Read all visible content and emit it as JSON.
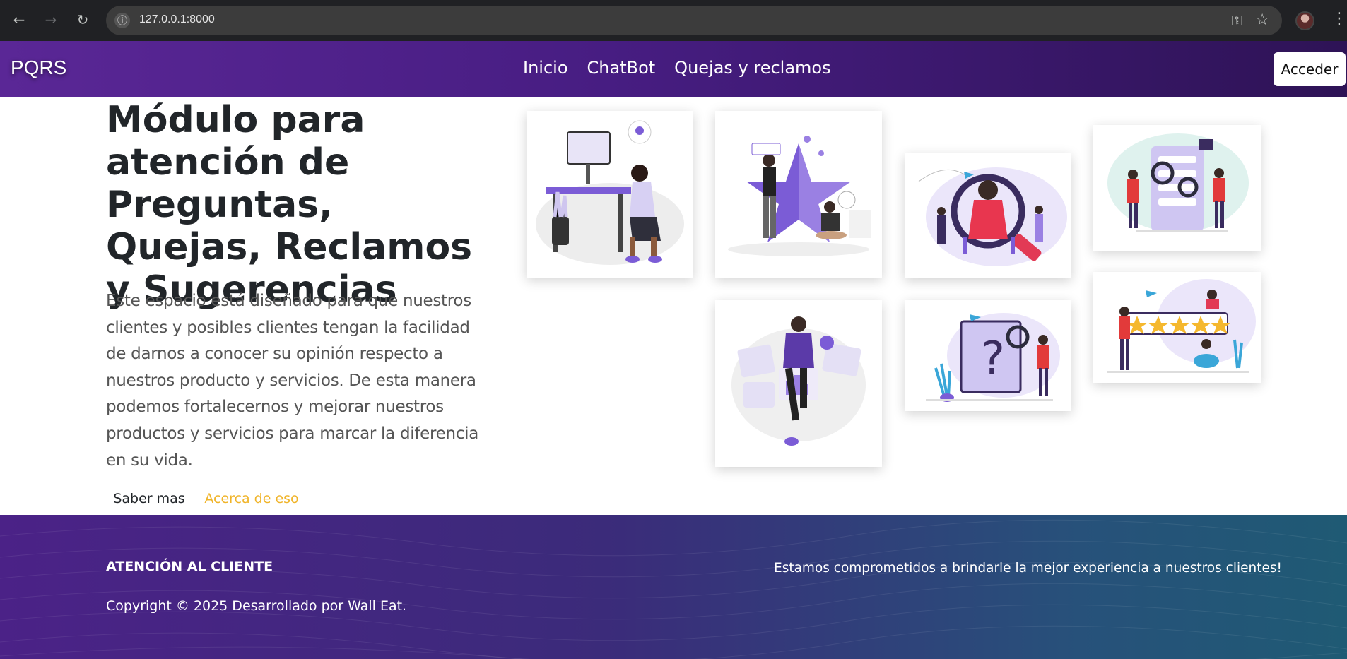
{
  "browser": {
    "url": "127.0.0.1:8000",
    "icons": {
      "back": "back-arrow-icon",
      "forward": "forward-arrow-icon",
      "reload": "reload-icon",
      "site_info": "site-info-icon",
      "password": "key-icon",
      "bookmark": "star-icon",
      "menu": "kebab-menu-icon"
    }
  },
  "navbar": {
    "brand": "PQRS",
    "links": [
      "Inicio",
      "ChatBot",
      "Quejas y reclamos"
    ],
    "login_label": "Acceder"
  },
  "hero": {
    "title": "Módulo para atención de Preguntas, Quejas, Reclamos y Sugerencias",
    "text": "Este espacio está diseñado para que nuestros clientes y posibles clientes tengan la facilidad de darnos a conocer su opinión respecto a nuestros producto y servicios. De esta manera podemos fortalecernos y mejorar nuestros productos y servicios para marcar la diferencia en su vida.",
    "btn_more": "Saber mas",
    "btn_about": "Acerca de eso"
  },
  "footer": {
    "heading": "ATENCIÓN AL CLIENTE",
    "copyright": "Copyright © 2025 Desarrollado por Wall Eat.",
    "tagline": "Estamos comprometidos a brindarle la mejor experiencia a nuestros clientes!"
  },
  "colors": {
    "navbar_start": "#5a2796",
    "navbar_end": "#2e1356",
    "accent_purple": "#7b5cd6",
    "about_link": "#f0b429",
    "footer_start": "#4b2287",
    "footer_end": "#1f5a74"
  }
}
